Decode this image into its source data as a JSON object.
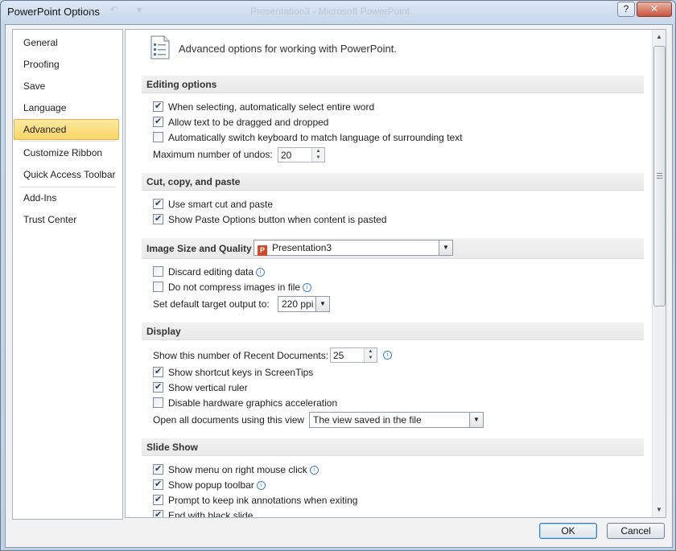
{
  "window": {
    "title": "PowerPoint Options",
    "background_title": "Presentation3 - Microsoft PowerPoint",
    "help_label": "?",
    "close_label": "✕"
  },
  "nav": {
    "items": [
      {
        "label": "General"
      },
      {
        "label": "Proofing"
      },
      {
        "label": "Save"
      },
      {
        "label": "Language"
      },
      {
        "label": "Advanced",
        "selected": true
      },
      {
        "label": "Customize Ribbon"
      },
      {
        "label": "Quick Access Toolbar"
      },
      {
        "label": "Add-Ins"
      },
      {
        "label": "Trust Center"
      }
    ]
  },
  "header": {
    "title": "Advanced options for working with PowerPoint.",
    "icon": "document-list-icon"
  },
  "sections": {
    "editing": {
      "title": "Editing options",
      "options": [
        {
          "label": "When selecting, automatically select entire word",
          "checked": true
        },
        {
          "label": "Allow text to be dragged and dropped",
          "checked": true
        },
        {
          "label": "Automatically switch keyboard to match language of surrounding text",
          "checked": false
        }
      ],
      "undos_label": "Maximum number of undos:",
      "undos_value": "20"
    },
    "cut_copy_paste": {
      "title": "Cut, copy, and paste",
      "options": [
        {
          "label": "Use smart cut and paste",
          "checked": true
        },
        {
          "label": "Show Paste Options button when content is pasted",
          "checked": true
        }
      ]
    },
    "image": {
      "title": "Image Size and Quality",
      "file_value": "Presentation3",
      "options": [
        {
          "label": "Discard editing data",
          "checked": false
        },
        {
          "label": "Do not compress images in file",
          "checked": false
        }
      ],
      "target_label": "Set default target output to:",
      "target_value": "220 ppi"
    },
    "display": {
      "title": "Display",
      "recent_label": "Show this number of Recent Documents:",
      "recent_value": "25",
      "options": [
        {
          "label": "Show shortcut keys in ScreenTips",
          "checked": true
        },
        {
          "label": "Show vertical ruler",
          "checked": true
        },
        {
          "label": "Disable hardware graphics acceleration",
          "checked": false
        }
      ],
      "open_label": "Open all documents using this view",
      "open_value": "The view saved in the file"
    },
    "slideshow": {
      "title": "Slide Show",
      "options": [
        {
          "label": "Show menu on right mouse click",
          "checked": true
        },
        {
          "label": "Show popup toolbar",
          "checked": true
        },
        {
          "label": "Prompt to keep ink annotations when exiting",
          "checked": true
        },
        {
          "label": "End with black slide",
          "checked": true
        }
      ]
    }
  },
  "buttons": {
    "ok": "OK",
    "cancel": "Cancel"
  }
}
